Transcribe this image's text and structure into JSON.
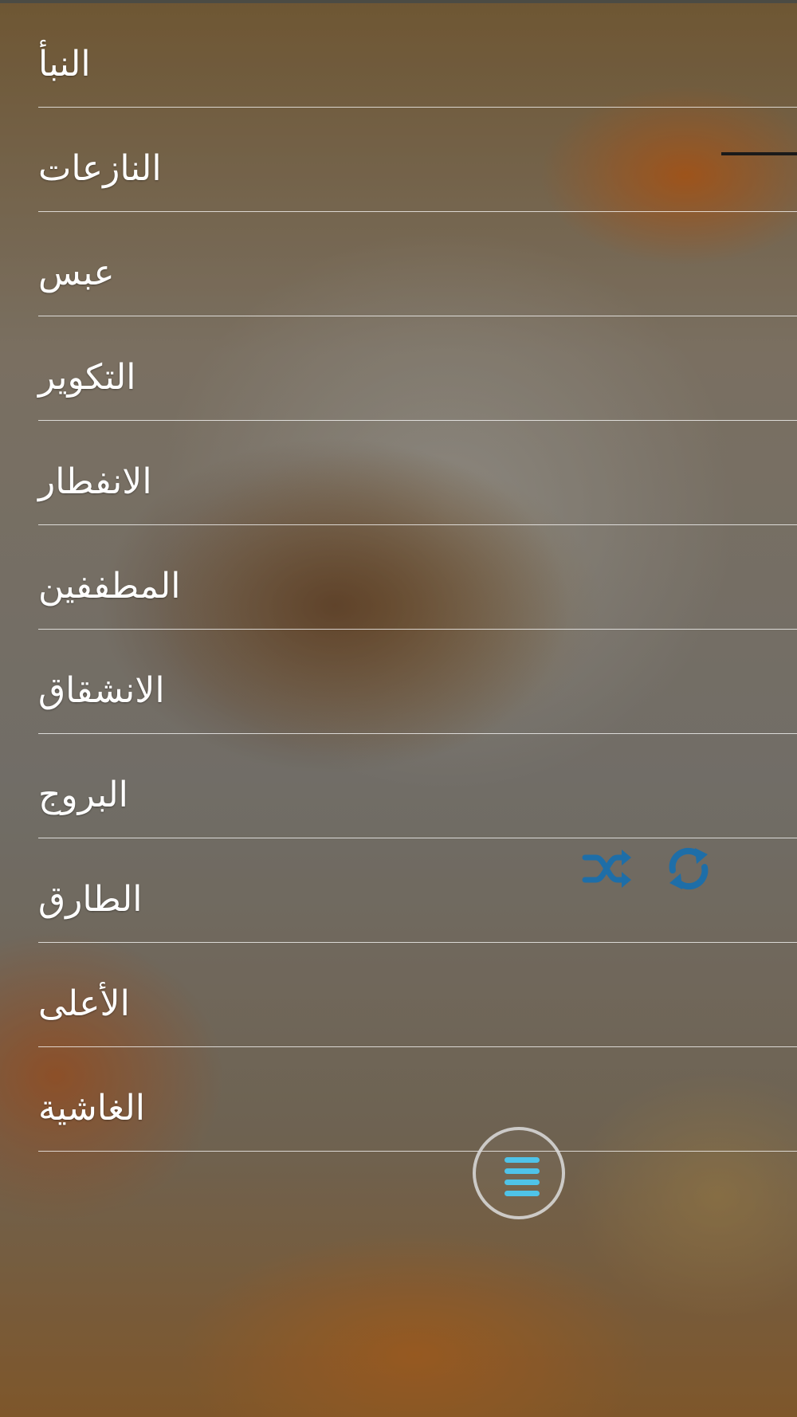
{
  "surah_list": [
    "النبأ",
    "النازعات",
    "عبس",
    "التكوير",
    "الانفطار",
    "المطففين",
    "الانشقاق",
    "البروج",
    "الطارق",
    "الأعلى",
    "الغاشية"
  ],
  "player": {
    "shuffle_icon": "shuffle-icon",
    "repeat_icon": "repeat-icon"
  },
  "menu_button": {
    "icon": "menu-icon"
  },
  "colors": {
    "item_text": "#ffffff",
    "divider": "#ffffff",
    "player_icon": "#1e6ea8",
    "menu_icon": "#4fc3e8"
  }
}
